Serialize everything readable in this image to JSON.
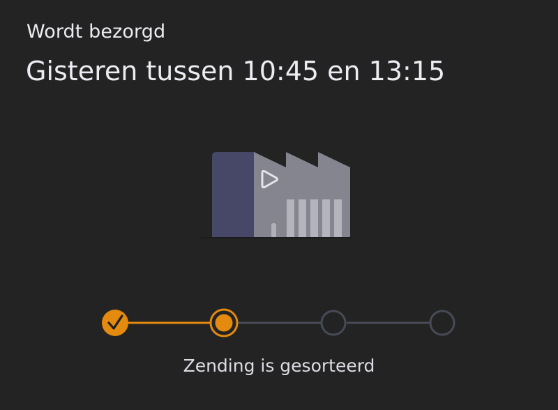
{
  "shipment": {
    "status_label": "Wordt bezorgd",
    "delivery_window": "Gisteren tussen 10:45 en 13:15"
  },
  "illustration": {
    "icon": "sorting-facility-icon"
  },
  "progress": {
    "current_step_caption": "Zending is gesorteerd",
    "total_steps": 4,
    "completed_steps": 1,
    "current_step": 2,
    "colors": {
      "active": "#e38a0f",
      "inactive": "#474b56",
      "background": "#232323"
    }
  }
}
